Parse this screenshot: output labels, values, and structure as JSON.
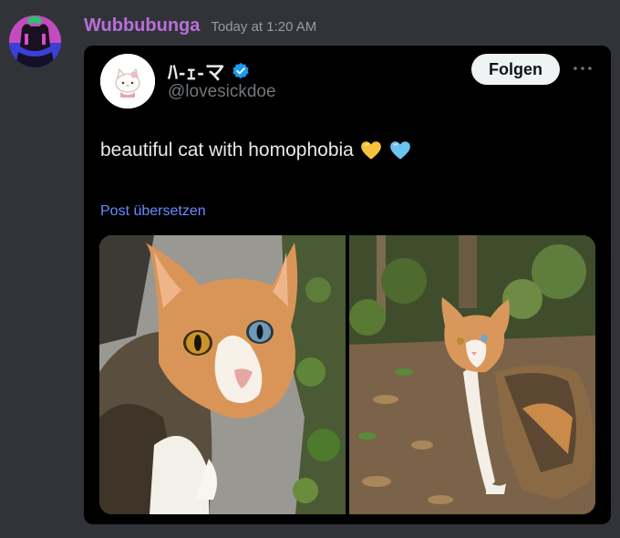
{
  "message": {
    "author": "Wubbubunga",
    "timestamp": "Today at 1:20 AM",
    "author_color": "#b86fd8"
  },
  "embed": {
    "display_name": "ﾊ-ｪ-マ",
    "handle": "@lovesickdoe",
    "verified": true,
    "follow_label": "Folgen",
    "text": "beautiful cat with homophobia",
    "emojis": [
      "yellow-heart-icon",
      "light-blue-heart-icon"
    ],
    "translate_label": "Post übersetzen",
    "images": [
      {
        "icon": "cat-closeup-photo"
      },
      {
        "icon": "cat-in-leaves-photo"
      }
    ]
  },
  "colors": {
    "background": "#313338",
    "embed_bg": "#000000",
    "link": "#6b8aff",
    "verified": "#1d9bf0"
  }
}
